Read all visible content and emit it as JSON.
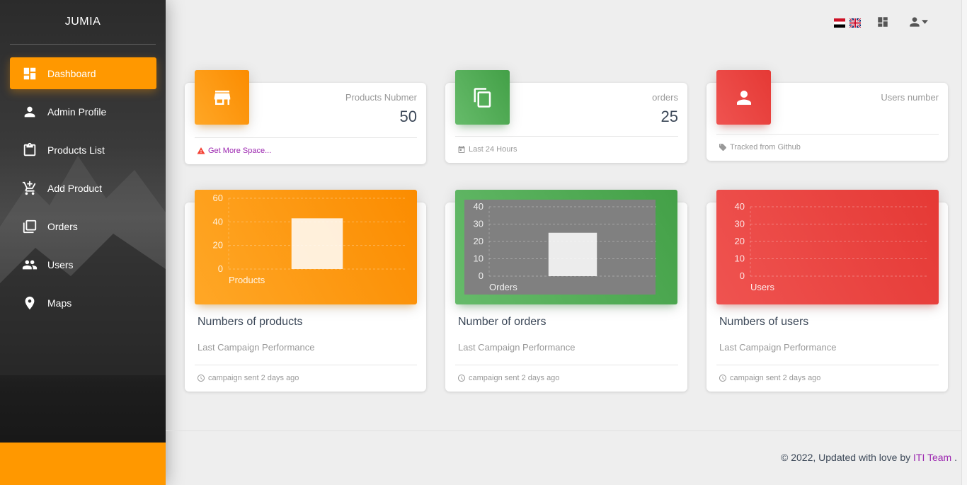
{
  "app": {
    "brand": "JUMIA"
  },
  "sidebar": {
    "items": [
      {
        "label": "Dashboard",
        "icon": "dashboard-icon",
        "active": true
      },
      {
        "label": "Admin Profile",
        "icon": "person-icon",
        "active": false
      },
      {
        "label": "Products List",
        "icon": "clipboard-icon",
        "active": false
      },
      {
        "label": "Add Product",
        "icon": "add-cart-icon",
        "active": false
      },
      {
        "label": "Orders",
        "icon": "library-icon",
        "active": false
      },
      {
        "label": "Users",
        "icon": "people-icon",
        "active": false
      },
      {
        "label": "Maps",
        "icon": "location-pin-icon",
        "active": false
      }
    ]
  },
  "topbar": {
    "flags": [
      "egypt-flag-icon",
      "uk-flag-icon"
    ],
    "icons": [
      "dashboard-icon",
      "person-icon",
      "caret-down-icon"
    ]
  },
  "stats": [
    {
      "label": "Products Nubmer",
      "value": "50",
      "footer": "Get More Space...",
      "footer_icon": "warning-icon",
      "icon": "store-icon",
      "color": "#ff9800"
    },
    {
      "label": "orders",
      "value": "25",
      "footer": "Last 24 Hours",
      "footer_icon": "calendar-icon",
      "icon": "content-copy-icon",
      "color": "#4caf50"
    },
    {
      "label": "Users number",
      "value": "",
      "footer": "Tracked from Github",
      "footer_icon": "tag-icon",
      "icon": "person-icon",
      "color": "#f44336"
    }
  ],
  "charts": [
    {
      "title": "Numbers of products",
      "subtitle": "Last Campaign Performance",
      "footer": "campaign sent 2 days ago"
    },
    {
      "title": "Number of orders",
      "subtitle": "Last Campaign Performance",
      "footer": "campaign sent 2 days ago"
    },
    {
      "title": "Numbers of users",
      "subtitle": "Last Campaign Performance",
      "footer": "campaign sent 2 days ago"
    }
  ],
  "chart_data": [
    {
      "type": "bar",
      "categories": [
        "Products"
      ],
      "values": [
        43
      ],
      "yticks": [
        0,
        20,
        40,
        60
      ],
      "ylim": [
        0,
        60
      ],
      "title": "",
      "xlabel": "",
      "ylabel": "",
      "grid": true,
      "legend": "none",
      "bg": "#ff9800"
    },
    {
      "type": "bar",
      "categories": [
        "Orders"
      ],
      "values": [
        25
      ],
      "yticks": [
        0,
        10,
        20,
        30,
        40
      ],
      "ylim": [
        0,
        40
      ],
      "title": "",
      "xlabel": "",
      "ylabel": "",
      "grid": true,
      "legend": "none",
      "bg": "#808080"
    },
    {
      "type": "bar",
      "categories": [
        "Users"
      ],
      "values": [
        0
      ],
      "yticks": [
        0,
        10,
        20,
        30,
        40
      ],
      "ylim": [
        0,
        40
      ],
      "title": "",
      "xlabel": "",
      "ylabel": "",
      "grid": true,
      "legend": "none",
      "bg": "#f44336"
    }
  ],
  "footer": {
    "text": "© 2022, Updated with love by ",
    "link": "ITI Team",
    "end": " ."
  }
}
